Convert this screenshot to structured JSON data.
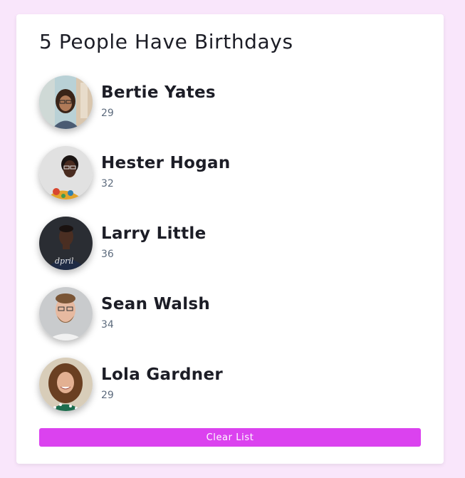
{
  "title": "5 People Have Birthdays",
  "people": [
    {
      "name": "Bertie Yates",
      "age": "29"
    },
    {
      "name": "Hester Hogan",
      "age": "32"
    },
    {
      "name": "Larry Little",
      "age": "36"
    },
    {
      "name": "Sean Walsh",
      "age": "34"
    },
    {
      "name": "Lola Gardner",
      "age": "29"
    }
  ],
  "clear_button": {
    "label": "Clear List"
  },
  "colors": {
    "background": "#f9e6fb",
    "card": "#ffffff",
    "button": "#db42ef",
    "name_text": "#1c1d26",
    "age_text": "#5d6b7d"
  }
}
